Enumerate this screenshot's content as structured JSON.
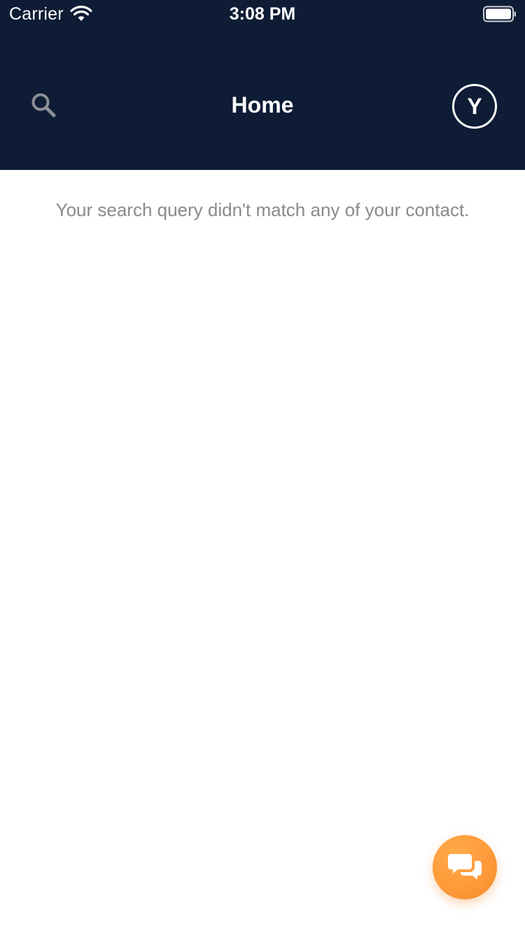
{
  "status_bar": {
    "carrier": "Carrier",
    "time": "3:08 PM"
  },
  "nav": {
    "title": "Home",
    "avatar_initial": "Y"
  },
  "content": {
    "empty_message": "Your search query didn't match any of your contact."
  },
  "icons": {
    "search": "search-icon",
    "wifi": "wifi-icon",
    "battery": "battery-icon",
    "chat": "chat-bubbles-icon"
  },
  "colors": {
    "header_bg": "#0e1c35",
    "accent_fab": "#ff9a3a",
    "message_text": "#8a8a8a"
  }
}
